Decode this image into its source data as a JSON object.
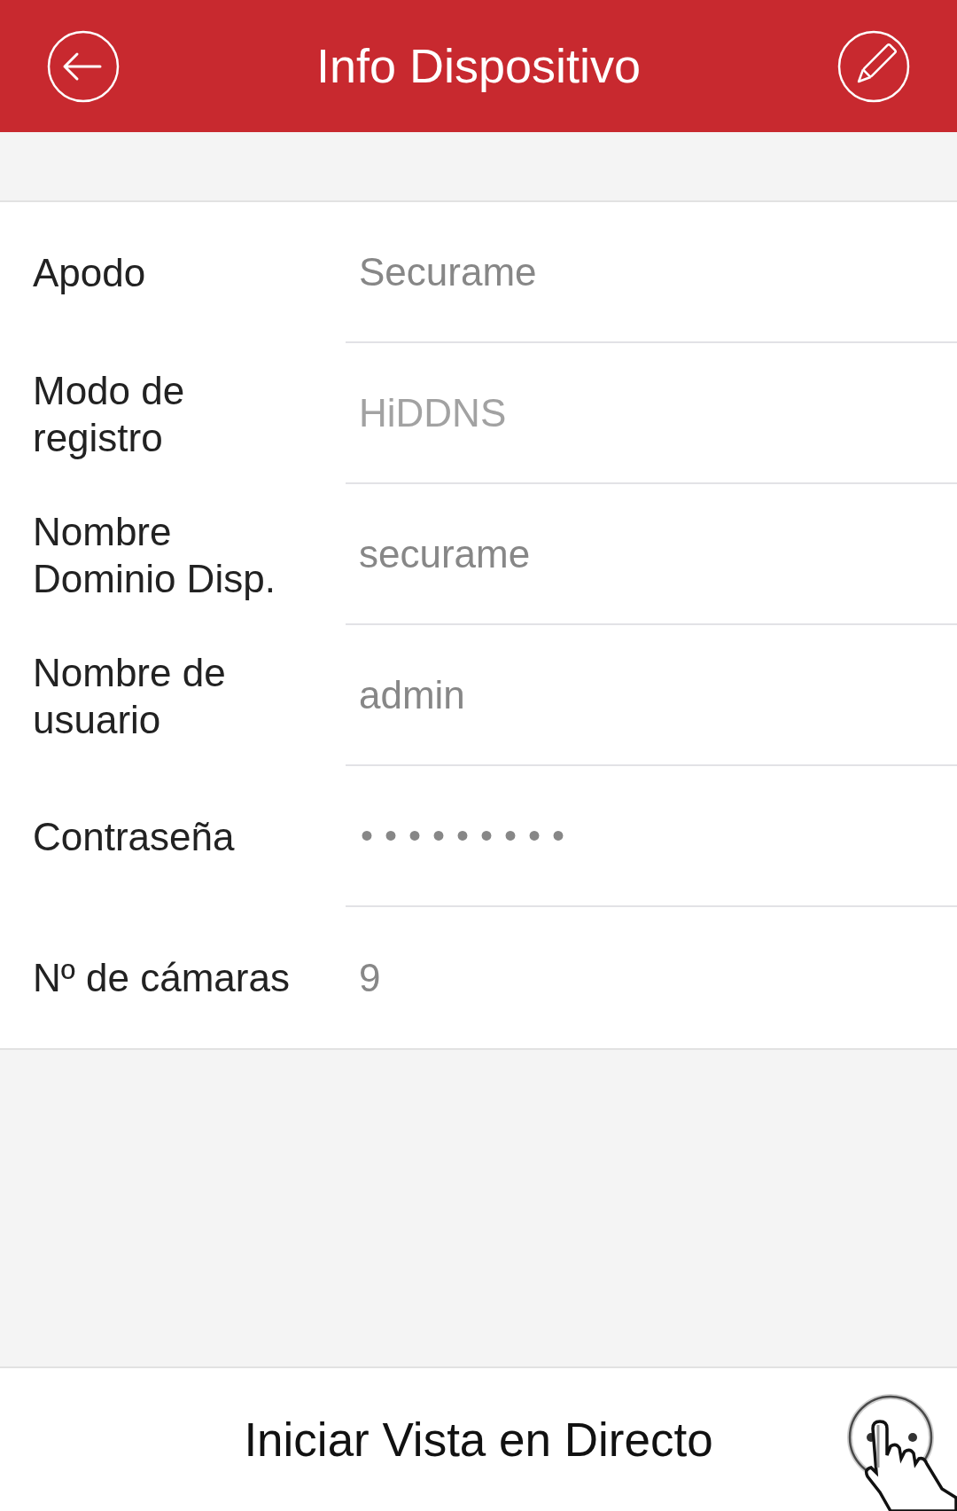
{
  "header": {
    "title": "Info Dispositivo"
  },
  "fields": [
    {
      "kind": "field",
      "label": "Apodo",
      "value": "Securame",
      "disabled": false
    },
    {
      "kind": "field",
      "label": "Modo de registro",
      "value": "HiDDNS",
      "disabled": true
    },
    {
      "kind": "field",
      "label": "Nombre Dominio Disp.",
      "value": "securame",
      "disabled": false
    },
    {
      "kind": "field",
      "label": "Nombre de usuario",
      "value": "admin",
      "disabled": false
    },
    {
      "kind": "password",
      "label": "Contraseña",
      "value": "•••••••••",
      "disabled": false
    },
    {
      "kind": "text",
      "label": "Nº de cámaras",
      "value": "9",
      "disabled": false
    }
  ],
  "action_bar": {
    "button": "Iniciar Vista en Directo"
  }
}
